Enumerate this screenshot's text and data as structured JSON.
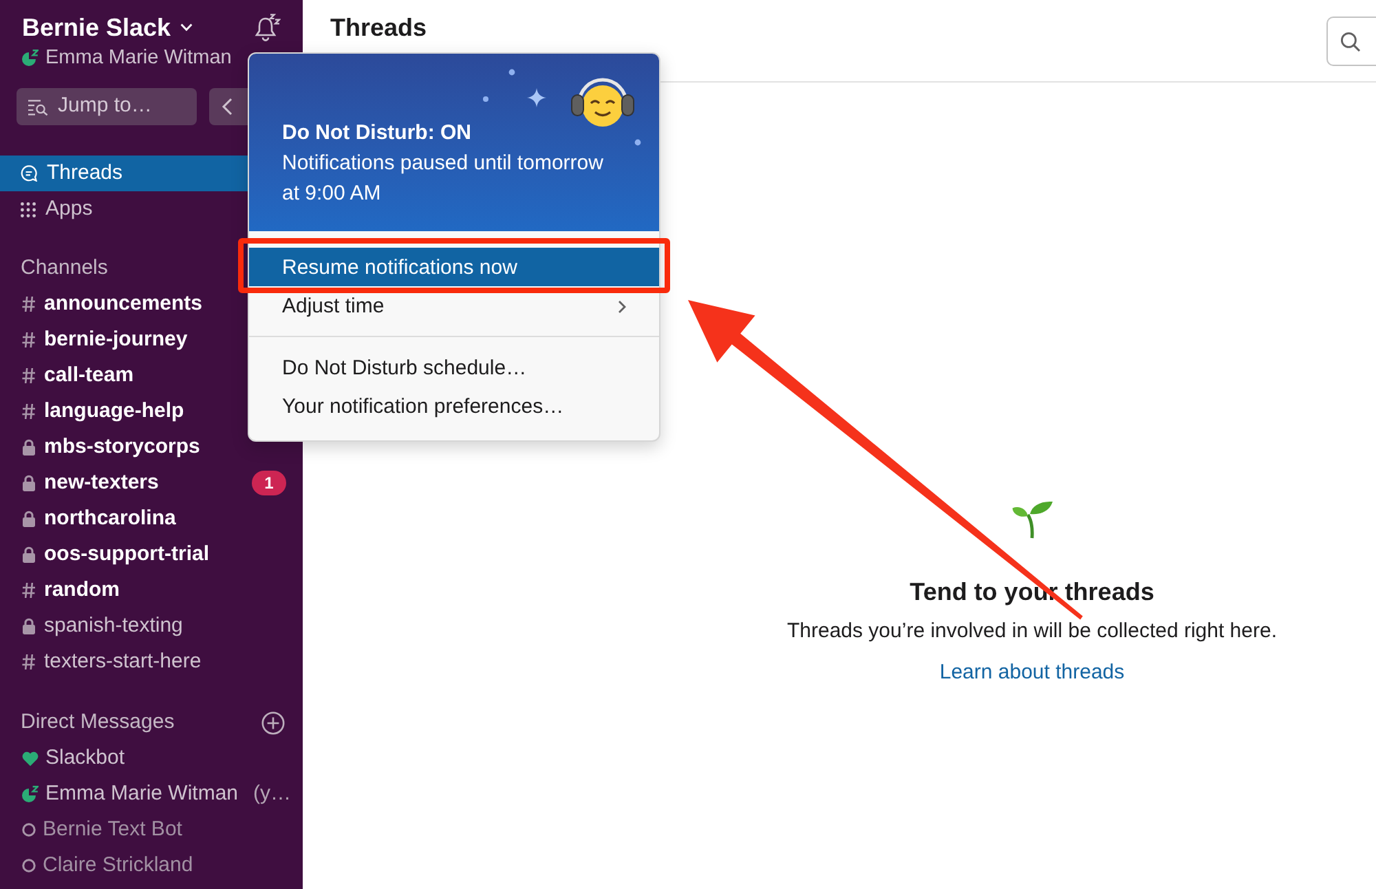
{
  "sidebar": {
    "workspace": "Bernie Slack",
    "user": {
      "name": "Emma Marie Witman",
      "kind": "dnd"
    },
    "jump_to": "Jump to…",
    "nav": [
      {
        "kind": "threads",
        "label": "Threads",
        "selected": true
      },
      {
        "kind": "apps",
        "label": "Apps",
        "selected": false
      }
    ],
    "channels": {
      "title": "Channels",
      "items": [
        {
          "name": "announcements",
          "kind": "public",
          "unread": true
        },
        {
          "name": "bernie-journey",
          "kind": "public",
          "unread": true
        },
        {
          "name": "call-team",
          "kind": "public",
          "unread": true
        },
        {
          "name": "language-help",
          "kind": "public",
          "unread": true
        },
        {
          "name": "mbs-storycorps",
          "kind": "private",
          "unread": true
        },
        {
          "name": "new-texters",
          "kind": "private",
          "unread": true,
          "badge": "1"
        },
        {
          "name": "northcarolina",
          "kind": "private",
          "unread": true
        },
        {
          "name": "oos-support-trial",
          "kind": "private",
          "unread": true
        },
        {
          "name": "random",
          "kind": "public",
          "unread": true
        },
        {
          "name": "spanish-texting",
          "kind": "private",
          "unread": false
        },
        {
          "name": "texters-start-here",
          "kind": "public",
          "unread": false
        }
      ]
    },
    "direct_messages": {
      "title": "Direct Messages",
      "items": [
        {
          "name": "Slackbot",
          "kind": "bot"
        },
        {
          "name": "Emma Marie Witman",
          "suffix": "(y…",
          "kind": "dnd"
        },
        {
          "name": "Bernie Text Bot",
          "kind": "away"
        },
        {
          "name": "Claire Strickland",
          "kind": "away"
        }
      ]
    }
  },
  "main": {
    "title": "Threads",
    "empty_state": {
      "title": "Tend to your threads",
      "text": "Threads you’re involved in will be collected right here.",
      "link": "Learn about threads"
    }
  },
  "dnd_menu": {
    "title": "Do Not Disturb: ON",
    "message": "Notifications paused until tomorrow at 9:00 AM",
    "groups": [
      [
        {
          "label": "Resume notifications now",
          "selected": true,
          "submenu": false
        },
        {
          "label": "Adjust time",
          "selected": false,
          "submenu": true
        }
      ],
      [
        {
          "label": "Do Not Disturb schedule…",
          "selected": false,
          "submenu": false
        },
        {
          "label": "Your notification preferences…",
          "selected": false,
          "submenu": false
        }
      ]
    ]
  },
  "annotations": {
    "frame": true,
    "arrow": true
  }
}
